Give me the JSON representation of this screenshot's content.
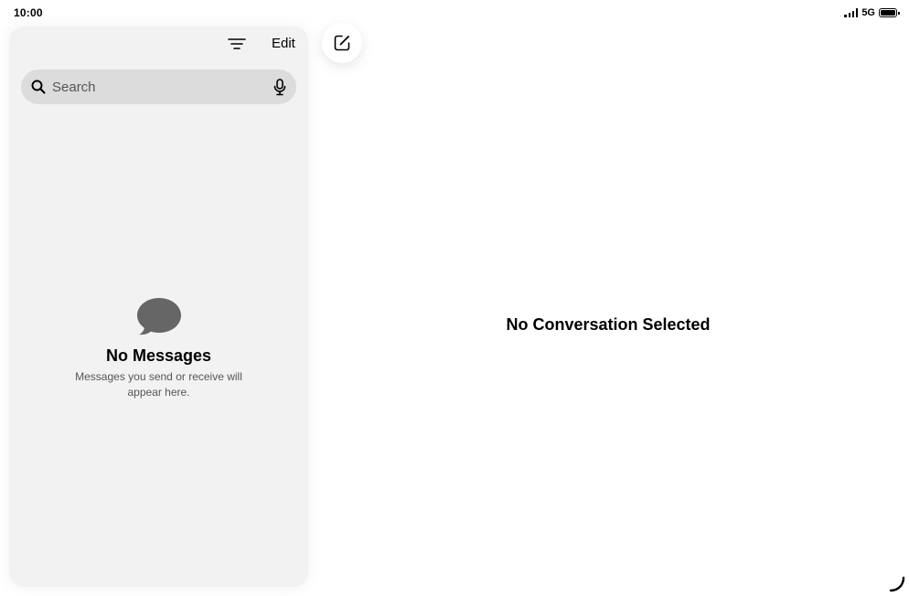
{
  "status_bar": {
    "time": "10:00",
    "network": "5G",
    "battery_level": 1.0
  },
  "sidebar": {
    "toolbar": {
      "filter_icon": "filter-icon",
      "edit_label": "Edit"
    },
    "search": {
      "placeholder": "Search",
      "value": "",
      "search_icon": "magnifying-glass-icon",
      "mic_icon": "microphone-icon"
    },
    "empty_state": {
      "icon": "message-bubble-icon",
      "title": "No Messages",
      "description": "Messages you send or receive will appear here."
    }
  },
  "compose": {
    "icon": "compose-icon"
  },
  "detail": {
    "placeholder_title": "No Conversation Selected"
  },
  "colors": {
    "sidebar_bg": "#f2f2f2",
    "search_bg": "#dcdcdc",
    "bubble_icon": "#666666",
    "secondary_text": "#555555"
  }
}
